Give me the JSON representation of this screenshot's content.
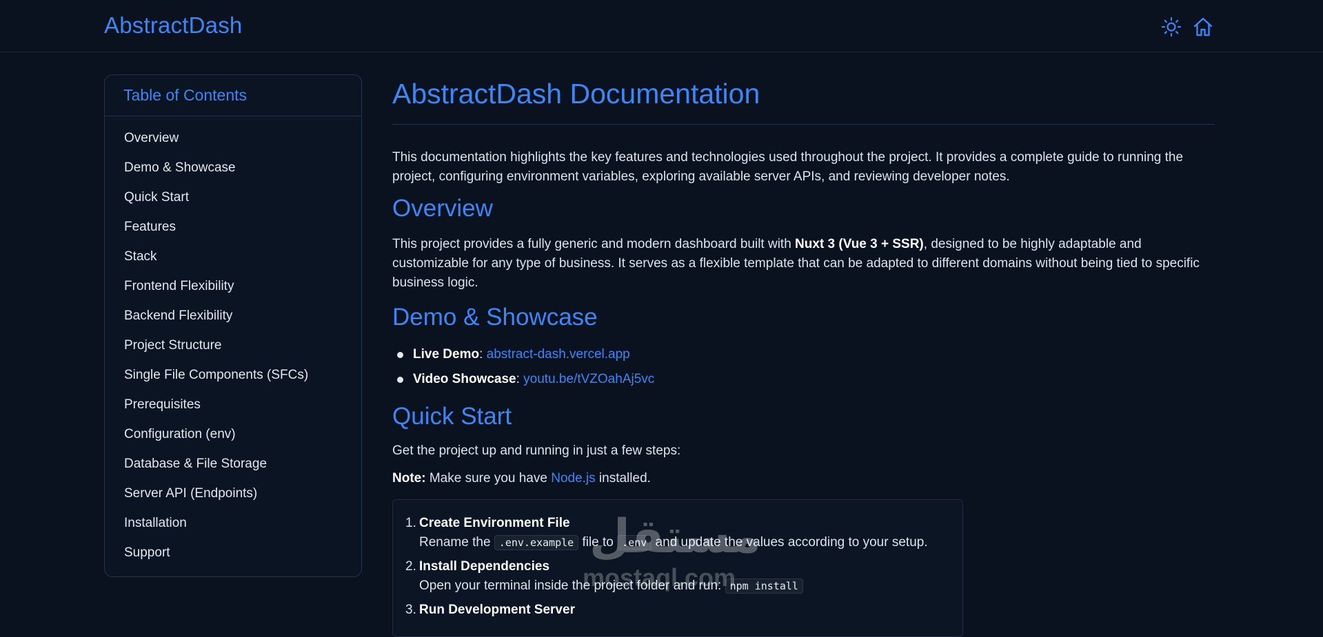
{
  "header": {
    "brand": "AbstractDash",
    "icons": [
      "sun-icon",
      "home-icon"
    ]
  },
  "toc": {
    "title": "Table of Contents",
    "items": [
      "Overview",
      "Demo & Showcase",
      "Quick Start",
      "Features",
      "Stack",
      "Frontend Flexibility",
      "Backend Flexibility",
      "Project Structure",
      "Single File Components (SFCs)",
      "Prerequisites",
      "Configuration (env)",
      "Database & File Storage",
      "Server API (Endpoints)",
      "Installation",
      "Support"
    ]
  },
  "doc": {
    "title": "AbstractDash Documentation",
    "intro": "This documentation highlights the key features and technologies used throughout the project. It provides a complete guide to running the project, configuring environment variables, exploring available server APIs, and reviewing developer notes.",
    "overview": {
      "heading": "Overview",
      "text_before": "This project provides a fully generic and modern dashboard built with ",
      "text_bold": "Nuxt 3 (Vue 3 + SSR)",
      "text_after": ", designed to be highly adaptable and customizable for any type of business. It serves as a flexible template that can be adapted to different domains without being tied to specific business logic."
    },
    "demo": {
      "heading": "Demo & Showcase",
      "live_label": "Live Demo",
      "live_link": "abstract-dash.vercel.app",
      "video_label": "Video Showcase",
      "video_link": "youtu.be/tVZOahAj5vc"
    },
    "quick_start": {
      "heading": "Quick Start",
      "intro": "Get the project up and running in just a few steps:",
      "note_label": "Note:",
      "note_before": " Make sure you have ",
      "note_link": "Node.js",
      "note_after": " installed.",
      "steps": [
        {
          "num": "1.",
          "title": "Create Environment File",
          "before": "Rename the ",
          "code1": ".env.example",
          "mid": " file to ",
          "code2": ".env",
          "after": " and update the values according to your setup."
        },
        {
          "num": "2.",
          "title": "Install Dependencies",
          "before": "Open your terminal inside the project folder and run: ",
          "code1": "npm install"
        },
        {
          "num": "3.",
          "title": "Run Development Server"
        }
      ]
    }
  },
  "watermark": {
    "arabic": "مستقل",
    "latin": "mostaql.com"
  },
  "colors": {
    "background": "#0a1220",
    "accent": "#3d86f5",
    "text": "#dde3ec",
    "border": "#22344a"
  }
}
